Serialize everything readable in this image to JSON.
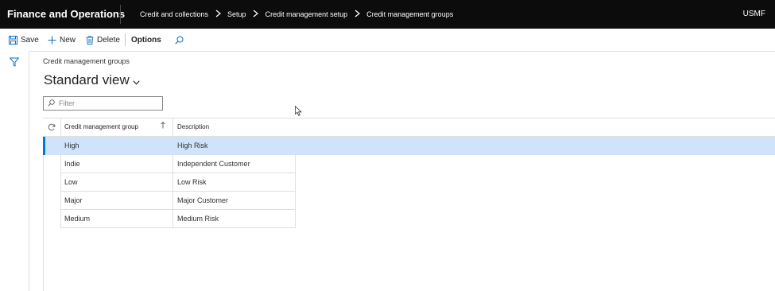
{
  "topbar": {
    "app_title": "Finance and Operations",
    "breadcrumb": [
      "Credit and collections",
      "Setup",
      "Credit management setup",
      "Credit management groups"
    ],
    "company": "USMF"
  },
  "actions": {
    "save": "Save",
    "new": "New",
    "delete": "Delete",
    "options": "Options",
    "search_icon": "search-icon"
  },
  "page": {
    "caption": "Credit management groups",
    "view_title": "Standard view"
  },
  "filter": {
    "placeholder": "Filter",
    "value": ""
  },
  "grid": {
    "columns": [
      "Credit management group",
      "Description"
    ],
    "sort": "ascending",
    "rows": [
      {
        "group": "High",
        "description": "High Risk",
        "selected": true
      },
      {
        "group": "Indie",
        "description": "Independent Customer",
        "selected": false
      },
      {
        "group": "Low",
        "description": "Low Risk",
        "selected": false
      },
      {
        "group": "Major",
        "description": "Major Customer",
        "selected": false
      },
      {
        "group": "Medium",
        "description": "Medium Risk",
        "selected": false
      }
    ]
  },
  "colors": {
    "topbar": "#0c0c0c",
    "accent": "#106ebe",
    "selected_row": "#cfe4fa",
    "selection_bar": "#0078d4"
  }
}
